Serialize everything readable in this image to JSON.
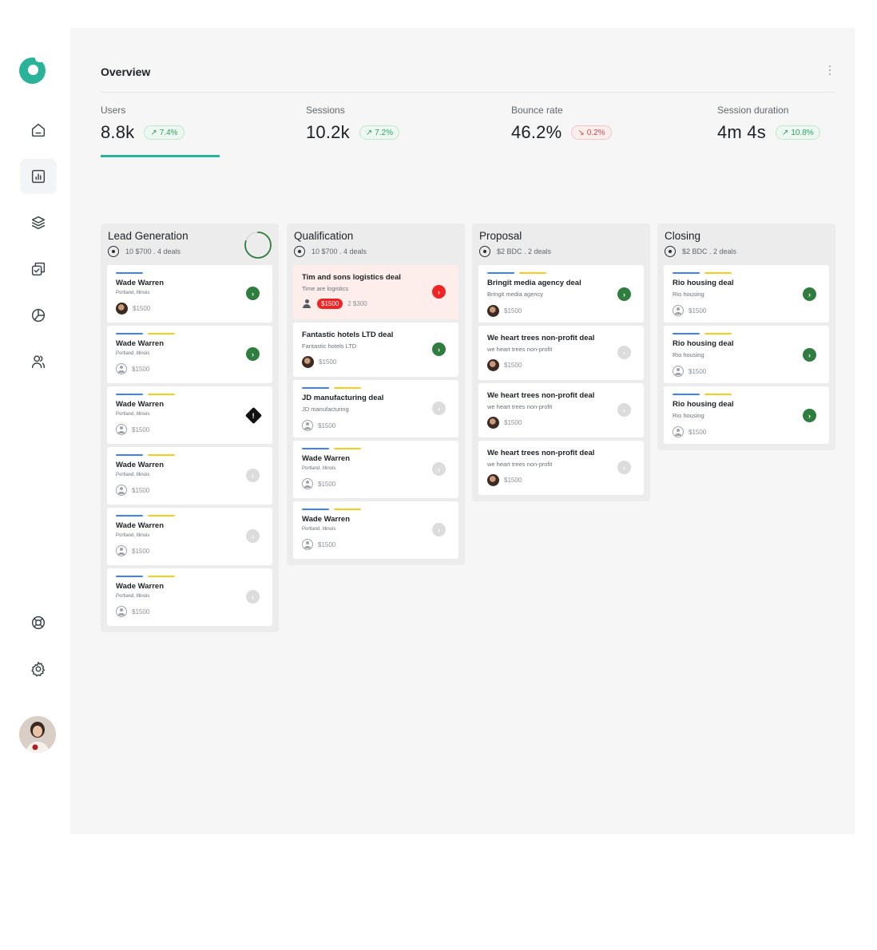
{
  "sidebar": {
    "icons": [
      "logo-icon",
      "home-icon",
      "chart-icon",
      "layers-icon",
      "tasks-icon",
      "pie-chart-icon",
      "users-icon",
      "support-icon",
      "settings-icon"
    ],
    "active": "chart-icon"
  },
  "overview": {
    "title": "Overview",
    "stats": [
      {
        "label": "Users",
        "value": "8.8k",
        "change": "7.4%",
        "trend": "up"
      },
      {
        "label": "Sessions",
        "value": "10.2k",
        "change": "7.2%",
        "trend": "up"
      },
      {
        "label": "Bounce rate",
        "value": "46.2%",
        "change": "0.2%",
        "trend": "down"
      },
      {
        "label": "Session duration",
        "value": "4m 4s",
        "change": "10.8%",
        "trend": "up"
      }
    ],
    "active_stat_index": 0
  },
  "board": {
    "columns": [
      {
        "title": "Lead Generation",
        "sub": "10 $700 . 4 deals",
        "progress_fraction": 0.8,
        "cards": [
          {
            "title": "Wade Warren",
            "sub": "Portland, Illinois",
            "price": "$1500"
          },
          {
            "title": "Wade Warren",
            "sub": "Portland, Illinois",
            "price": "$1500"
          },
          {
            "title": "Wade Warren",
            "sub": "Portland, Illinois",
            "price": "$1500"
          },
          {
            "title": "Wade Warren",
            "sub": "Portland, Illinois",
            "price": "$1500"
          },
          {
            "title": "Wade Warren",
            "sub": "Portland, Illinois",
            "price": "$1500"
          },
          {
            "title": "Wade Warren",
            "sub": "Portland, Illinois",
            "price": "$1500"
          }
        ]
      },
      {
        "title": "Qualification",
        "sub": "10 $700 . 4 deals",
        "cards": [
          {
            "title": "Tim  and sons logistics deal",
            "sub": "Time are logistics",
            "price": "$1500",
            "extra": "2 $300"
          },
          {
            "title": "Fantastic hotels LTD deal",
            "sub": "Fantastic hotels LTD",
            "price": "$1500"
          },
          {
            "title": "JD manufacturing deal",
            "sub": "JD manufacturing",
            "price": "$1500"
          },
          {
            "title": "Wade Warren",
            "sub": "Portland, Illinois",
            "price": "$1500"
          },
          {
            "title": "Wade Warren",
            "sub": "Portland, Illinois",
            "price": "$1500"
          }
        ]
      },
      {
        "title": "Proposal",
        "sub": "$2 BDC . 2 deals",
        "cards": [
          {
            "title": "Bringit media agency deal",
            "sub": "Bringit media agency",
            "price": "$1500"
          },
          {
            "title": "We heart trees non-profit deal",
            "sub": "we heart trees non-profit",
            "price": "$1500"
          },
          {
            "title": "We heart trees non-profit deal",
            "sub": "we heart trees non-profit",
            "price": "$1500"
          },
          {
            "title": "We heart trees non-profit deal",
            "sub": "we heart trees non-profit",
            "price": "$1500"
          }
        ]
      },
      {
        "title": "Closing",
        "sub": "$2 BDC . 2 deals",
        "cards": [
          {
            "title": "Rio housing deal",
            "sub": "Rio housing",
            "price": "$1500"
          },
          {
            "title": "Rio housing deal",
            "sub": "Rio housing",
            "price": "$1500"
          },
          {
            "title": "Rio housing deal",
            "sub": "Rio housing",
            "price": "$1500"
          }
        ]
      }
    ]
  },
  "colors": {
    "accent": "#2bb39a",
    "go": "#2f7d3f",
    "alert": "#ef2424",
    "bar_blue": "#3b82f6",
    "bar_yellow": "#facc15"
  }
}
